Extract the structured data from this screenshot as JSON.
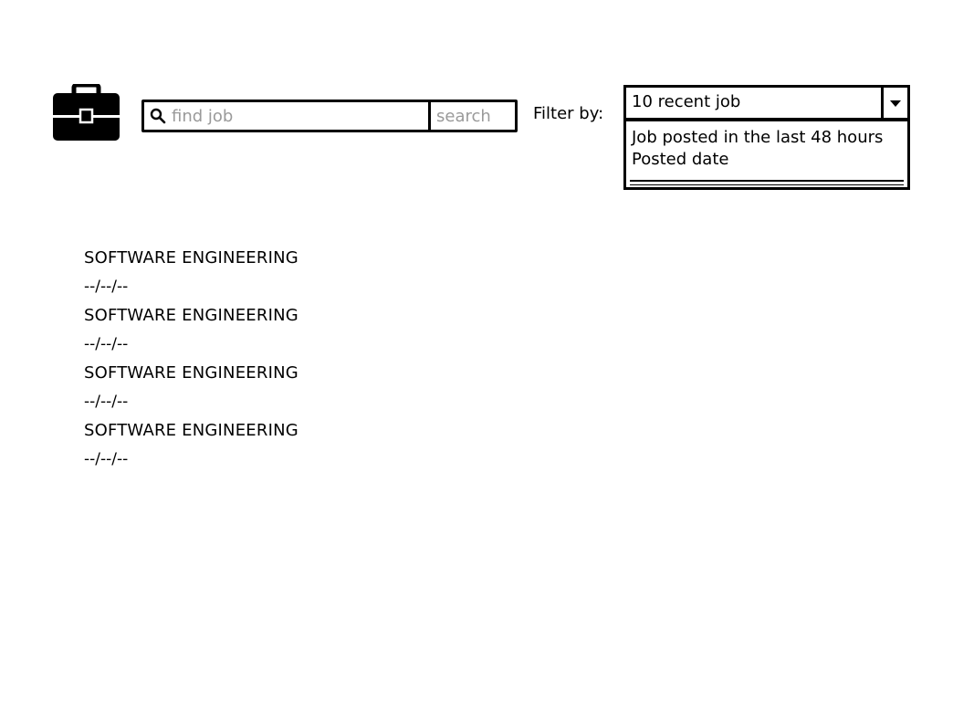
{
  "header": {
    "logo_icon": "briefcase-icon",
    "search": {
      "icon": "search-icon",
      "placeholder": "find job",
      "value": "",
      "button_label": "search"
    },
    "filter": {
      "label": "Filter by:",
      "selected": "10 recent job",
      "arrow_icon": "triangle-down-icon",
      "options": [
        "Job posted in the last 48 hours",
        "Posted date"
      ]
    }
  },
  "jobs": [
    {
      "title": "SOFTWARE ENGINEERING",
      "date": "--/--/--"
    },
    {
      "title": "SOFTWARE ENGINEERING",
      "date": "--/--/--"
    },
    {
      "title": "SOFTWARE ENGINEERING",
      "date": "--/--/--"
    },
    {
      "title": "SOFTWARE ENGINEERING",
      "date": "--/--/--"
    }
  ]
}
